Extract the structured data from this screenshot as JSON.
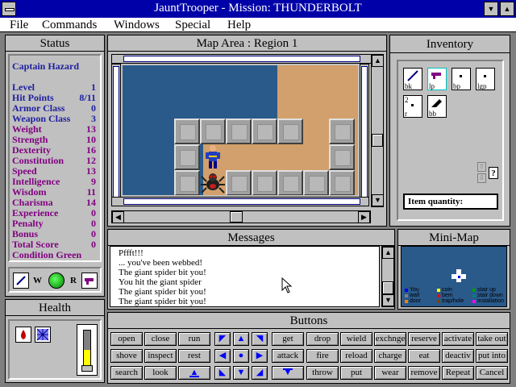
{
  "window": {
    "title": "JauntTrooper - Mission: THUNDERBOLT"
  },
  "menu": [
    "File",
    "Commands",
    "Windows",
    "Special",
    "Help"
  ],
  "status": {
    "heading": "Status",
    "name": "Captain Hazard",
    "stats": [
      {
        "label": "Level",
        "value": "1"
      },
      {
        "label": "Hit Points",
        "value": "8/11"
      },
      {
        "label": "Armor Class",
        "value": "0"
      },
      {
        "label": "Weapon Class",
        "value": "3"
      },
      {
        "label": "Weight",
        "value": "13"
      },
      {
        "label": "Strength",
        "value": "10"
      },
      {
        "label": "Dexterity",
        "value": "16"
      },
      {
        "label": "Constitution",
        "value": "12"
      },
      {
        "label": "Speed",
        "value": "13"
      },
      {
        "label": "Intelligence",
        "value": "9"
      },
      {
        "label": "Wisdom",
        "value": "11"
      },
      {
        "label": "Charisma",
        "value": "14"
      },
      {
        "label": "Experience",
        "value": "0"
      },
      {
        "label": "Penalty",
        "value": "0"
      },
      {
        "label": "Bonus",
        "value": "0"
      },
      {
        "label": "Total Score",
        "value": "0"
      },
      {
        "label": "Condition",
        "value": "Green"
      }
    ],
    "weapon_label": "W",
    "ranged_label": "R"
  },
  "health": {
    "heading": "Health",
    "level": 0.45
  },
  "map": {
    "heading": "Map Area : Region 1",
    "colors": {
      "water": "#2a5a8a",
      "floor": "#d2a06c"
    }
  },
  "messages": {
    "heading": "Messages",
    "lines": [
      "Pffft!!!",
      "... you've been webbed!",
      "The giant spider bit you!",
      "You hit the giant spider",
      "The giant spider bit you!",
      "The giant spider bit you!"
    ]
  },
  "inventory": {
    "heading": "Inventory",
    "items": [
      {
        "label": "bk"
      },
      {
        "label": "lp"
      },
      {
        "label": "bp"
      },
      {
        "label": "lgp"
      },
      {
        "label": "r",
        "count": "2"
      },
      {
        "label": "bb"
      }
    ],
    "quantity_label": "Item quantity:",
    "help_label": "?"
  },
  "minimap": {
    "heading": "Mini-Map",
    "legend": [
      {
        "label": "You",
        "color": "#0000ff"
      },
      {
        "label": "wall",
        "color": "#808080"
      },
      {
        "label": "door",
        "color": "#ff8000"
      },
      {
        "label": "coin",
        "color": "#ffff00"
      },
      {
        "label": "bem",
        "color": "#ff0000"
      },
      {
        "label": "trap/hole",
        "color": "#804000"
      },
      {
        "label": "stair up",
        "color": "#00a000"
      },
      {
        "label": "stair down",
        "color": "#008080"
      },
      {
        "label": "installation",
        "color": "#ff00ff"
      }
    ]
  },
  "buttons": {
    "heading": "Buttons",
    "col1": [
      "open",
      "shove",
      "search"
    ],
    "col2": [
      "close",
      "inspect",
      "look"
    ],
    "col3": [
      "run",
      "rest",
      ""
    ],
    "col5": [
      "get",
      "attack",
      "throw"
    ],
    "col6": [
      "drop",
      "fire",
      "put"
    ],
    "col7": [
      "wield",
      "reload",
      "wear"
    ],
    "col8": [
      "exchnge",
      "charge",
      "remove"
    ],
    "col9": [
      "reserve",
      "eat",
      "Repeat"
    ],
    "col10": [
      "activate",
      "deactiv",
      "Cancel"
    ],
    "col11": [
      "take out",
      "put into",
      ""
    ]
  }
}
